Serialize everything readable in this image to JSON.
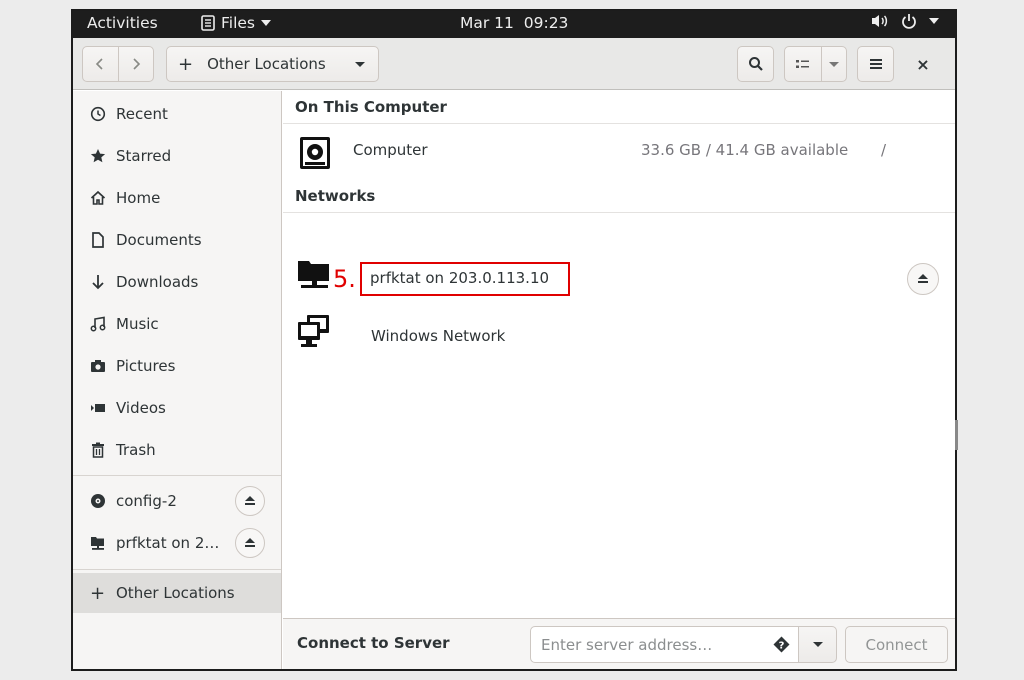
{
  "topbar": {
    "activities": "Activities",
    "app_menu": "Files",
    "clock": "Mar 11  09:23"
  },
  "headerbar": {
    "path_label": "Other Locations",
    "close_glyph": "×"
  },
  "sidebar": {
    "items": [
      {
        "label": "Recent",
        "icon": "clock-icon"
      },
      {
        "label": "Starred",
        "icon": "star-icon"
      },
      {
        "label": "Home",
        "icon": "home-icon"
      },
      {
        "label": "Documents",
        "icon": "document-icon"
      },
      {
        "label": "Downloads",
        "icon": "download-icon"
      },
      {
        "label": "Music",
        "icon": "music-icon"
      },
      {
        "label": "Pictures",
        "icon": "camera-icon"
      },
      {
        "label": "Videos",
        "icon": "video-icon"
      },
      {
        "label": "Trash",
        "icon": "trash-icon"
      }
    ],
    "mounts": [
      {
        "label": "config-2",
        "icon": "disc-icon"
      },
      {
        "label": "prfktat on 2…",
        "icon": "network-folder-icon"
      }
    ],
    "other_locations": "Other Locations"
  },
  "main": {
    "on_this_computer": "On This Computer",
    "computer": {
      "name": "Computer",
      "size": "33.6 GB / 41.4 GB available",
      "path": "/"
    },
    "networks": "Networks",
    "network_share": {
      "name": "prfktat on 203.0.113.10",
      "annotation": "5."
    },
    "windows_network": "Windows Network"
  },
  "connect_bar": {
    "label": "Connect to Server",
    "placeholder": "Enter server address…",
    "button": "Connect"
  },
  "colors": {
    "annotation": "#e00000",
    "topbar": "#1d1d1d",
    "sidebar_bg": "#f6f5f4"
  }
}
